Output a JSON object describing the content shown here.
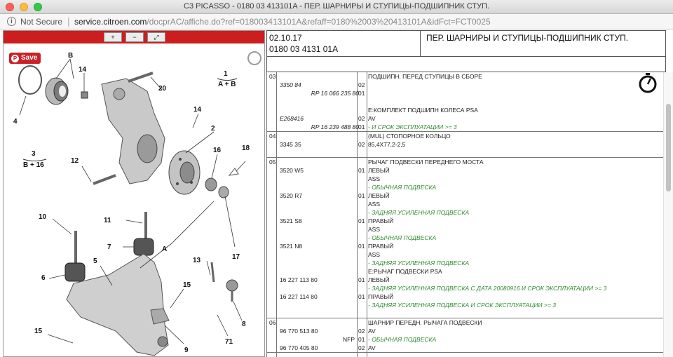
{
  "window": {
    "title": "C3 PICASSO - 0180 03 413101A - ПЕР. ШАРНИРЫ И СТУПИЦЫ-ПОДШИПНИК СТУП."
  },
  "address": {
    "security_label": "Not Secure",
    "url_host": "service.citroen.com",
    "url_path": "/docprAC/affiche.do?ref=018003413101A&refaff=0180%2003%20413101A&idFct=FCT0025"
  },
  "diagram": {
    "save_label": "Save",
    "zoom_in_label": "+",
    "zoom_out_label": "−",
    "zoom_fit_label": "⤢",
    "labels": {
      "B": "B",
      "1": "1",
      "AB": "A + B",
      "14a": "14",
      "20": "20",
      "4": "4",
      "14b": "14",
      "2": "2",
      "3": "3",
      "B16": "B + 16",
      "12": "12",
      "16": "16",
      "18": "18",
      "11": "11",
      "10": "10",
      "7": "7",
      "A": "A",
      "17": "17",
      "5": "5",
      "13": "13",
      "6": "6",
      "15a": "15",
      "8": "8",
      "9": "9",
      "71": "71",
      "15b": "15"
    }
  },
  "header": {
    "date": "02.10.17",
    "doc_ref": "0180 03 4131 01A",
    "title": "ПЕР. ШАРНИРЫ И СТУПИЦЫ-ПОДШИПНИК СТУП."
  },
  "table": {
    "groups": [
      {
        "num": "03",
        "rows": [
          {
            "ref": "",
            "qty": "",
            "desc": "ПОДШИПН. ПЕРЕД СТУПИЦЫ В СБОРЕ",
            "green": false
          },
          {
            "ref": "3350 84",
            "ref_italic": true,
            "qty": "02",
            "desc": "",
            "green": false
          },
          {
            "sub": "RP 16 066 235 80",
            "qty": "01",
            "desc": "",
            "green": false
          },
          {
            "ref": "",
            "qty": "",
            "desc": "",
            "green": false
          },
          {
            "ref": "",
            "qty": "",
            "desc": "E:КОМПЛЕКТ ПОДШИПН КОЛЕСА PSA",
            "green": false
          },
          {
            "ref": "E268416",
            "ref_italic": true,
            "qty": "02",
            "desc": "AV",
            "green": false
          },
          {
            "sub": "RP 16 239 488 80",
            "qty": "01",
            "desc": "- И СРОК ЭКСПЛУАТАЦИИ >= 3",
            "green": true
          }
        ]
      },
      {
        "num": "04",
        "rows": [
          {
            "ref": "",
            "qty": "",
            "desc": "(MUL) СТОПОРНОЕ КОЛЬЦО",
            "green": false
          },
          {
            "ref": "3345 35",
            "qty": "02",
            "desc": "85,4X77,2-2,5",
            "green": false
          },
          {
            "ref": "",
            "qty": "",
            "desc": "",
            "green": false
          }
        ]
      },
      {
        "num": "05",
        "rows": [
          {
            "ref": "",
            "qty": "",
            "desc": "РЫЧАГ ПОДВЕСКИ ПЕРЕДНЕГО МОСТА",
            "green": false
          },
          {
            "ref": "3520 W5",
            "qty": "01",
            "desc": "ЛЕВЫЙ",
            "green": false
          },
          {
            "ref": "",
            "qty": "",
            "desc": "ASS",
            "green": false
          },
          {
            "ref": "",
            "qty": "",
            "desc": "- ОБЫЧНАЯ ПОДВЕСКА",
            "green": true
          },
          {
            "ref": "3520 R7",
            "qty": "01",
            "desc": "ЛЕВЫЙ",
            "green": false
          },
          {
            "ref": "",
            "qty": "",
            "desc": "ASS",
            "green": false
          },
          {
            "ref": "",
            "qty": "",
            "desc": "- ЗАДНЯЯ УСИЛЕННАЯ ПОДВЕСКА",
            "green": true
          },
          {
            "ref": "3521 S8",
            "qty": "01",
            "desc": "ПРАВЫЙ",
            "green": false
          },
          {
            "ref": "",
            "qty": "",
            "desc": "ASS",
            "green": false
          },
          {
            "ref": "",
            "qty": "",
            "desc": "- ОБЫЧНАЯ ПОДВЕСКА",
            "green": true
          },
          {
            "ref": "3521 N8",
            "qty": "01",
            "desc": "ПРАВЫЙ",
            "green": false
          },
          {
            "ref": "",
            "qty": "",
            "desc": "ASS",
            "green": false
          },
          {
            "ref": "",
            "qty": "",
            "desc": "- ЗАДНЯЯ УСИЛЕННАЯ ПОДВЕСКА",
            "green": true
          },
          {
            "ref": "",
            "qty": "",
            "desc": "E:РЫЧАГ ПОДВЕСКИ PSA",
            "green": false
          },
          {
            "ref": "16 227 113 80",
            "qty": "01",
            "desc": "ЛЕВЫЙ",
            "green": false
          },
          {
            "ref": "",
            "qty": "",
            "desc": "- ЗАДНЯЯ УСИЛЕННАЯ ПОДВЕСКА С ДАТА 20080916 И СРОК ЭКСПЛУАТАЦИИ >= 3",
            "green": true
          },
          {
            "ref": "16 227 114 80",
            "qty": "01",
            "desc": "ПРАВЫЙ",
            "green": false
          },
          {
            "ref": "",
            "qty": "",
            "desc": "- ЗАДНЯЯ УСИЛЕННАЯ ПОДВЕСКА И СРОК ЭКСПЛУАТАЦИИ >= 3",
            "green": true
          },
          {
            "ref": "",
            "qty": "",
            "desc": "",
            "green": false
          }
        ]
      },
      {
        "num": "06",
        "rows": [
          {
            "ref": "",
            "qty": "",
            "desc": "ШАРНИР ПЕРЕДН. РЫЧАГА ПОДВЕСКИ",
            "green": false
          },
          {
            "ref": "96 770 513 80",
            "qty": "02",
            "desc": "AV",
            "green": false
          },
          {
            "nfp": "NFP",
            "qty": "01",
            "desc": "- ОБЫЧНАЯ ПОДВЕСКА",
            "green": true
          },
          {
            "ref": "96 770 405 80",
            "qty": "02",
            "desc": "AV",
            "green": false
          }
        ]
      }
    ]
  }
}
